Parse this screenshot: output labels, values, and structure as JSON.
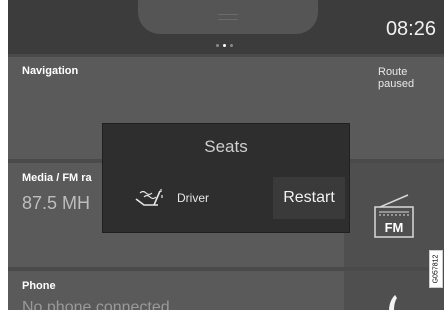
{
  "status_bar": {
    "time": "08:26",
    "pages": 3,
    "active_page": 1
  },
  "tiles": {
    "navigation": {
      "label": "Navigation",
      "status": "Route paused"
    },
    "media": {
      "label": "Media / FM ra",
      "frequency": "87.5 MH",
      "source_icon_text": "FM"
    },
    "phone": {
      "label": "Phone",
      "status": "No phone connected"
    }
  },
  "popup": {
    "title": "Seats",
    "driver_label": "Driver",
    "restart_label": "Restart"
  },
  "figure_code": "G057812",
  "colors": {
    "background": "#4a4a4a",
    "popup": "#2e2e2e",
    "text": "#ffffff"
  }
}
